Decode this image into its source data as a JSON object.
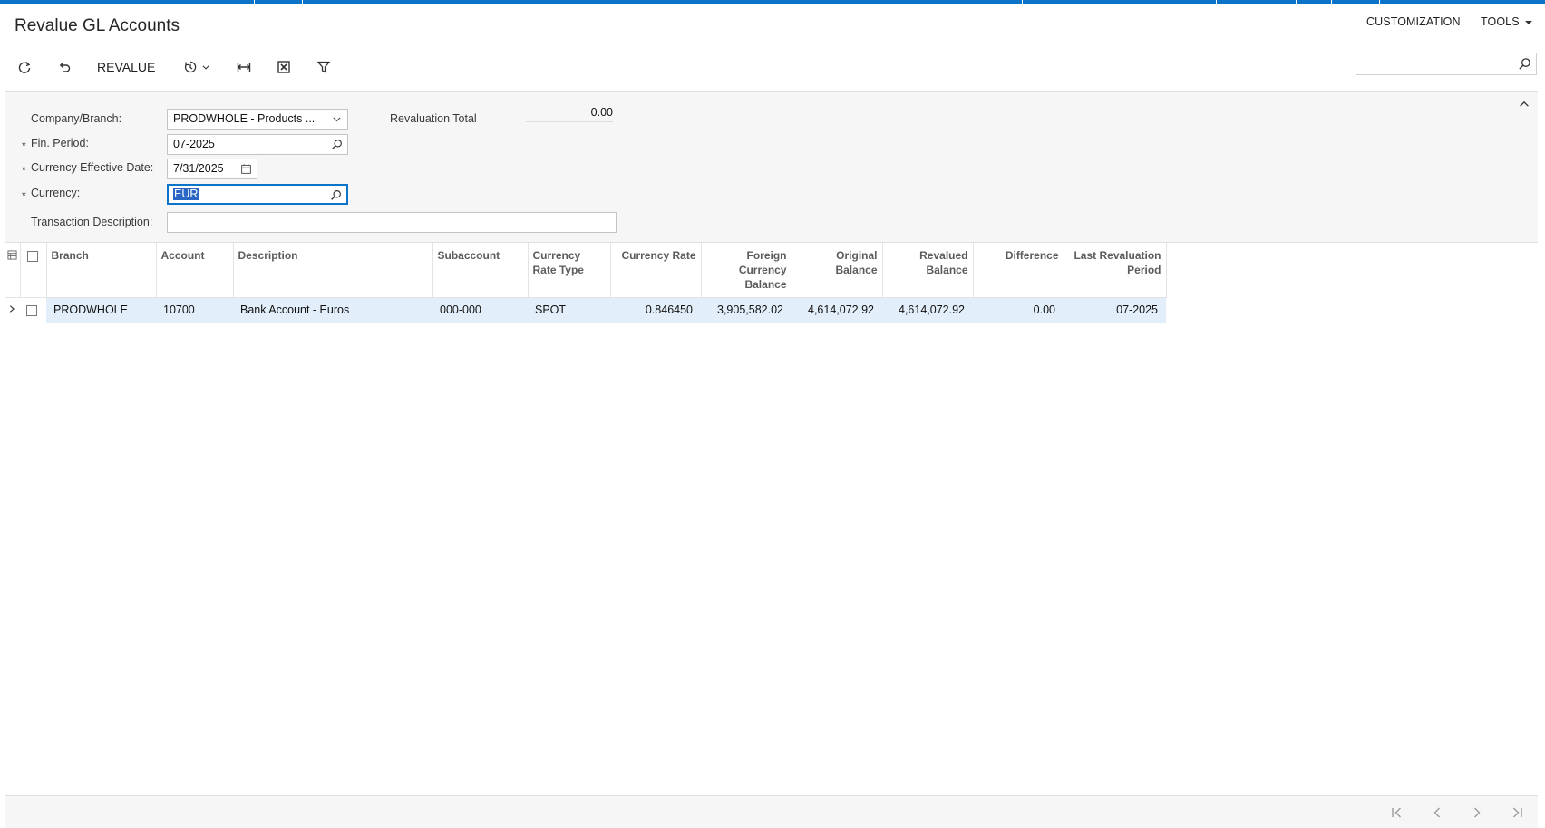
{
  "page": {
    "title": "Revalue GL Accounts"
  },
  "top_menu": {
    "customization": "CUSTOMIZATION",
    "tools": "TOOLS"
  },
  "toolbar": {
    "revalue_label": "REVALUE"
  },
  "form": {
    "company_branch": {
      "label": "Company/Branch:",
      "value": "PRODWHOLE - Products ..."
    },
    "fin_period": {
      "label": "Fin. Period:",
      "value": "07-2025"
    },
    "currency_effective_date": {
      "label": "Currency Effective Date:",
      "value": "7/31/2025"
    },
    "currency": {
      "label": "Currency:",
      "value": "EUR"
    },
    "transaction_description": {
      "label": "Transaction Description:",
      "value": ""
    },
    "revaluation_total": {
      "label": "Revaluation Total",
      "value": "0.00"
    },
    "required_mark": "*"
  },
  "grid": {
    "columns": [
      {
        "key": "branch",
        "label": "Branch"
      },
      {
        "key": "account",
        "label": "Account"
      },
      {
        "key": "description",
        "label": "Description"
      },
      {
        "key": "subaccount",
        "label": "Subaccount"
      },
      {
        "key": "rate_type",
        "label": "Currency Rate Type"
      },
      {
        "key": "rate",
        "label": "Currency Rate"
      },
      {
        "key": "foreign_balance",
        "label": "Foreign Currency Balance"
      },
      {
        "key": "original_balance",
        "label": "Original Balance"
      },
      {
        "key": "revalued_balance",
        "label": "Revalued Balance"
      },
      {
        "key": "difference",
        "label": "Difference"
      },
      {
        "key": "last_period",
        "label": "Last Revaluation Period"
      }
    ],
    "rows": [
      {
        "branch": "PRODWHOLE",
        "account": "10700",
        "description": "Bank Account - Euros",
        "subaccount": "000-000",
        "rate_type": "SPOT",
        "rate": "0.846450",
        "foreign_balance": "3,905,582.02",
        "original_balance": "4,614,072.92",
        "revalued_balance": "4,614,072.92",
        "difference": "0.00",
        "last_period": "07-2025"
      }
    ]
  },
  "colors": {
    "accent": "#0b74c9",
    "selected_row": "#e2eef9",
    "panel": "#f6f6f6"
  }
}
